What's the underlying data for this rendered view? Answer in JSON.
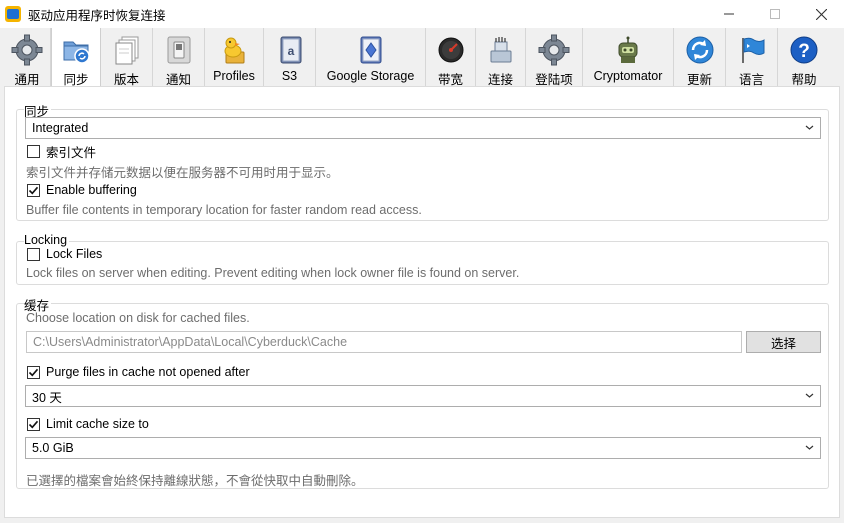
{
  "window": {
    "title": "驱动应用程序时恢复连接"
  },
  "toolbar": {
    "tabs": [
      {
        "label": "通用",
        "icon": "gear-icon"
      },
      {
        "label": "同步",
        "icon": "sync-icon"
      },
      {
        "label": "版本",
        "icon": "versions-icon"
      },
      {
        "label": "通知",
        "icon": "toggle-icon"
      },
      {
        "label": "Profiles",
        "icon": "duck-icon"
      },
      {
        "label": "S3",
        "icon": "s3-icon"
      },
      {
        "label": "Google Storage",
        "icon": "google-storage-icon"
      },
      {
        "label": "带宽",
        "icon": "gauge-icon"
      },
      {
        "label": "连接",
        "icon": "network-icon"
      },
      {
        "label": "登陆项",
        "icon": "gear-icon"
      },
      {
        "label": "Cryptomator",
        "icon": "robot-icon"
      },
      {
        "label": "更新",
        "icon": "update-icon"
      },
      {
        "label": "语言",
        "icon": "flag-icon"
      },
      {
        "label": "帮助",
        "icon": "help-icon"
      }
    ],
    "active": "同步"
  },
  "sync": {
    "title": "同步",
    "mode_value": "Integrated",
    "index_label": "索引文件",
    "index_checked": false,
    "index_desc": "索引文件并存储元数据以便在服务器不可用时用于显示。",
    "buffer_label": "Enable buffering",
    "buffer_checked": true,
    "buffer_desc": "Buffer file contents in temporary location for faster random read access."
  },
  "locking": {
    "title": "Locking",
    "lock_label": "Lock Files",
    "lock_checked": false,
    "lock_desc": "Lock files on server when editing. Prevent editing when lock owner file is found on server."
  },
  "cache": {
    "title": "缓存",
    "location_desc": "Choose location on disk for cached files.",
    "path_value": "C:\\Users\\Administrator\\AppData\\Local\\Cyberduck\\Cache",
    "choose_label": "选择",
    "purge_label": "Purge files in cache not opened after",
    "purge_checked": true,
    "purge_value": "30 天",
    "limit_label": "Limit cache size to",
    "limit_checked": true,
    "limit_value": "5.0 GiB",
    "footer_desc": "已選擇的檔案會始終保持離線狀態，不會從快取中自動刪除。"
  },
  "colors": {
    "accent": "#1f6fd1",
    "desc_text": "#6d6d6d",
    "panel_bg": "#ffffff",
    "window_bg": "#f0f0f0"
  }
}
